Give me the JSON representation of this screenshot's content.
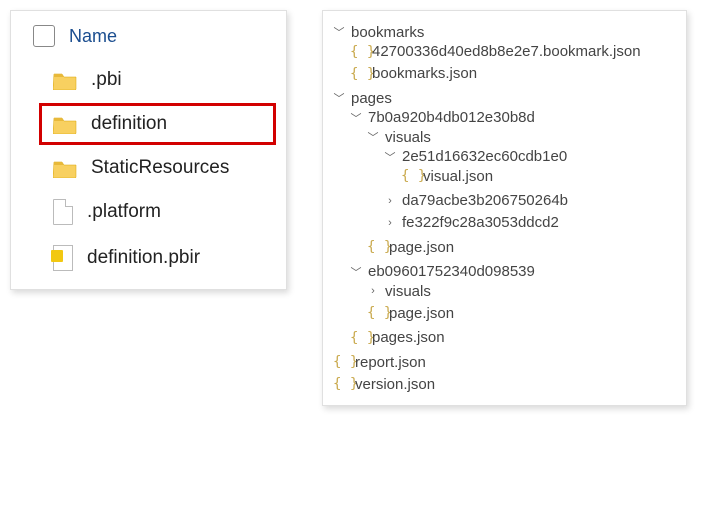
{
  "explorer": {
    "header": "Name",
    "items": [
      {
        "name": ".pbi",
        "type": "folder"
      },
      {
        "name": "definition",
        "type": "folder",
        "highlighted": true
      },
      {
        "name": "StaticResources",
        "type": "folder"
      },
      {
        "name": ".platform",
        "type": "file"
      },
      {
        "name": "definition.pbir",
        "type": "pbir"
      }
    ]
  },
  "icons": {
    "braces": "{ }"
  },
  "tree": {
    "bookmarks": {
      "label": "bookmarks",
      "file1": "42700336d40ed8b8e2e7.bookmark.json",
      "file2": "bookmarks.json"
    },
    "pages": {
      "label": "pages",
      "page1": {
        "label": "7b0a920b4db012e30b8d",
        "visuals_label": "visuals",
        "v1": {
          "label": "2e51d16632ec60cdb1e0",
          "file": "visual.json"
        },
        "v2": "da79acbe3b206750264b",
        "v3": "fe322f9c28a3053ddcd2",
        "pagejson": "page.json"
      },
      "page2": {
        "label": "eb09601752340d098539",
        "visuals_label": "visuals",
        "pagejson": "page.json"
      },
      "pagesjson": "pages.json"
    },
    "reportjson": "report.json",
    "versionjson": "version.json"
  }
}
